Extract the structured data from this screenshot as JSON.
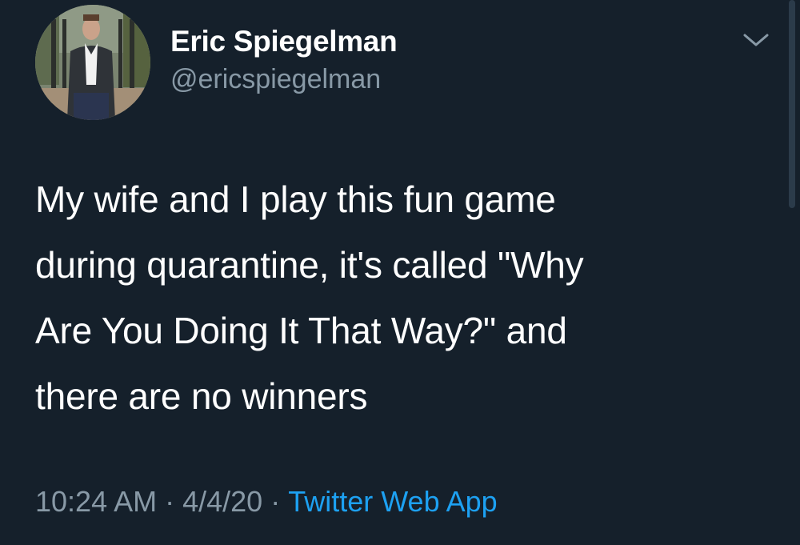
{
  "tweet": {
    "author": {
      "display_name": "Eric Spiegelman",
      "handle": "@ericspiegelman"
    },
    "text_lines": [
      "My wife and I play this fun game",
      "during quarantine, it's called \"Why",
      "Are You Doing It That Way?\" and",
      "there are no winners"
    ],
    "time": "10:24 AM",
    "date": "4/4/20",
    "separator": "·",
    "source": "Twitter Web App"
  },
  "icons": {
    "menu": "chevron-down-icon"
  },
  "colors": {
    "background": "#15202b",
    "primary_text": "#ffffff",
    "secondary_text": "#8899a6",
    "link": "#1da1f2"
  }
}
